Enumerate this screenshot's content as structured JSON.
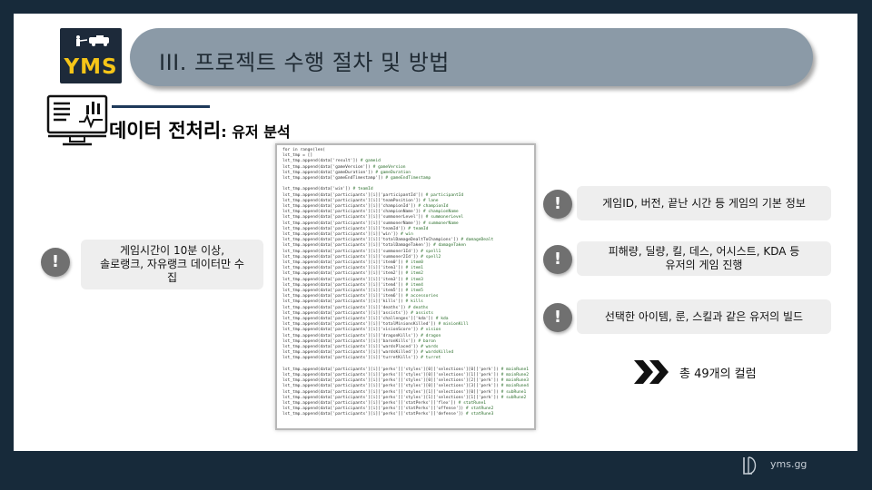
{
  "logo": {
    "text": "YMS"
  },
  "header": {
    "title": "III. 프로젝트 수행 절차 및 방법"
  },
  "section": {
    "title_main": "데이터 전처리",
    "title_sub": ": 유저 분석"
  },
  "code_lines": [
    "for   in range(len(",
    "  lst_tmp = []",
    "  lst_tmp.append(data['result']) # gameid",
    "  lst_tmp.append(data['gameVersion']) # gameVersion",
    "  lst_tmp.append(data['gameDuration']) # gameDuration",
    "  lst_tmp.append(data['gameEndTimestamp']) # gameEndTimestamp",
    "",
    "  lst_tmp.append(data['win']) # teamId",
    "  lst_tmp.append(data['participants'][i]['participantId']) # participantId",
    "  lst_tmp.append(data['participants'][i]['teamPosition']) # lane",
    "  lst_tmp.append(data['participants'][i]['championId']) # championId",
    "  lst_tmp.append(data['participants'][i]['championName']) # championName",
    "  lst_tmp.append(data['participants'][i]['summonerLevel']) # summonerLevel",
    "  lst_tmp.append(data['participants'][i]['summonerName']) # summonerName",
    "  lst_tmp.append(data['participants'][i]['teamId']) # teamId",
    "  lst_tmp.append(data['participants'][i]['win']) # win",
    "  lst_tmp.append(data['participants'][i]['totalDamageDealtToChampions']) # damageDealt",
    "  lst_tmp.append(data['participants'][i]['totalDamageTaken']) # damageTaken",
    "  lst_tmp.append(data['participants'][i]['summoner1Id']) # spell1",
    "  lst_tmp.append(data['participants'][i]['summoner2Id']) # spell2",
    "  lst_tmp.append(data['participants'][i]['item0']) # item0",
    "  lst_tmp.append(data['participants'][i]['item1']) # item1",
    "  lst_tmp.append(data['participants'][i]['item2']) # item2",
    "  lst_tmp.append(data['participants'][i]['item3']) # item3",
    "  lst_tmp.append(data['participants'][i]['item4']) # item4",
    "  lst_tmp.append(data['participants'][i]['item5']) # item5",
    "  lst_tmp.append(data['participants'][i]['item6']) # accessories",
    "  lst_tmp.append(data['participants'][i]['kills']) # kills",
    "  lst_tmp.append(data['participants'][i]['deaths']) # deaths",
    "  lst_tmp.append(data['participants'][i]['assists']) # assists",
    "  lst_tmp.append(data['participants'][i]['challenges']['kda']) # kda",
    "  lst_tmp.append(data['participants'][i]['totalMinionsKilled']) # minionKill",
    "  lst_tmp.append(data['participants'][i]['visionScore']) # vision",
    "  lst_tmp.append(data['participants'][i]['dragonKills']) # dragon",
    "  lst_tmp.append(data['participants'][i]['baronKills']) # baron",
    "  lst_tmp.append(data['participants'][i]['wardsPlaced']) # wards",
    "  lst_tmp.append(data['participants'][i]['wardsKilled']) # wardsKilled",
    "  lst_tmp.append(data['participants'][i]['turretKills']) # turret",
    "",
    "  lst_tmp.append(data['participants'][i]['perks']['styles'][0]['selections'][0]['perk']) # mainRune1",
    "  lst_tmp.append(data['participants'][i]['perks']['styles'][0]['selections'][1]['perk']) # mainRune2",
    "  lst_tmp.append(data['participants'][i]['perks']['styles'][0]['selections'][2]['perk']) # mainRune3",
    "  lst_tmp.append(data['participants'][i]['perks']['styles'][0]['selections'][3]['perk']) # mainRune4",
    "  lst_tmp.append(data['participants'][i]['perks']['styles'][1]['selections'][0]['perk']) # subRune1",
    "  lst_tmp.append(data['participants'][i]['perks']['styles'][1]['selections'][1]['perk']) # subRune2",
    "  lst_tmp.append(data['participants'][i]['perks']['statPerks']['flex']) # statRune1",
    "  lst_tmp.append(data['participants'][i]['perks']['statPerks']['offense']) # statRune2",
    "  lst_tmp.append(data['participants'][i]['perks']['statPerks']['defense']) # statRune3"
  ],
  "left_card": {
    "text": "게임시간이 10분 이상,\n솔로랭크, 자유랭크 데이터만 수\n집"
  },
  "right_cards": [
    {
      "text": "게임ID, 버전, 끝난 시간 등 게임의 기본 정보"
    },
    {
      "text": "피해량, 딜량, 킬, 데스, 어시스트, KDA 등\n유저의 게임 진행"
    },
    {
      "text": "선택한 아이템, 룬, 스킬과 같은 유저의 빌드"
    }
  ],
  "bang_symbol": "!",
  "total": {
    "label": "총 49개의 컬럼"
  },
  "footer": {
    "text": "yms.gg"
  },
  "colors": {
    "background": "#172a3a",
    "title_bar": "#8b9aa7",
    "logo_yellow": "#f5c518",
    "bang": "#707070"
  }
}
